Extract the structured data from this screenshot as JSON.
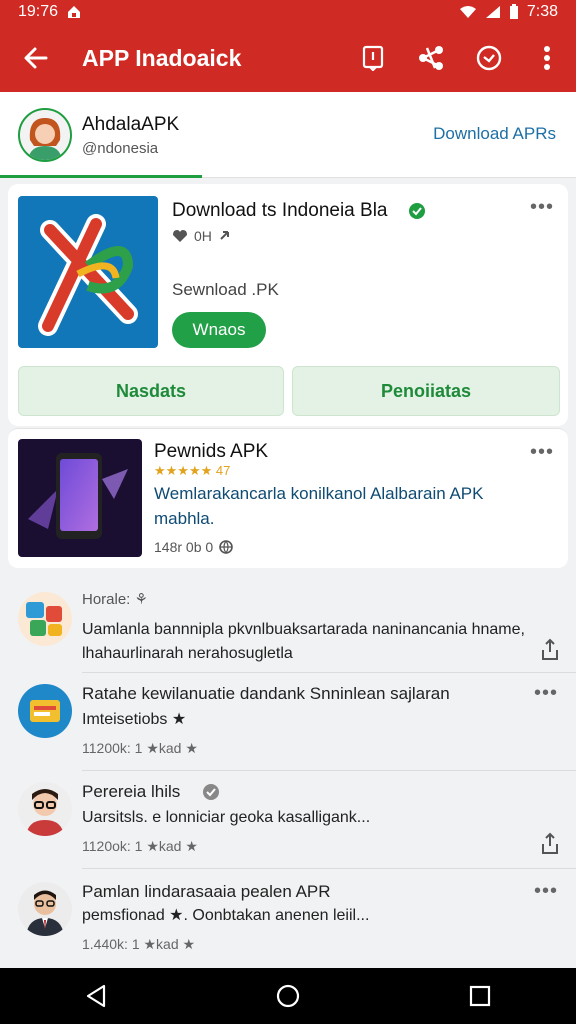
{
  "status": {
    "time_left": "19:76",
    "time_right": "7:38"
  },
  "appbar": {
    "title": "APP Inadoaick"
  },
  "profile": {
    "name": "AhdalaAPK",
    "handle": "@ndonesia",
    "link": "Download APRs"
  },
  "featured": {
    "title": "Download ts Indoneia Bla",
    "meta": "0H",
    "subtitle": "Sewnload .PK",
    "pill": "Wnaos",
    "btn_left": "Nasdats",
    "btn_right": "Penoiiatas"
  },
  "item2": {
    "title": "Pewnids APK",
    "rating": "★★★★★ 47",
    "desc": "Wemlarakancarla konilkanol Alalbarain APK mabhla.",
    "meta": "148r 0b 0"
  },
  "posts": [
    {
      "title": "Horale: ⚘",
      "body": "Uamlanla bannnipla pkvnlbuaksartarada naninancania hname, lhahaurlinarah nerahosugletla",
      "meta": ""
    },
    {
      "title": "Ratahe kewilanuatie dandank Snninlean sajlaran",
      "body": "Imteisetiobs ★",
      "meta": "11200k: 1 ★kad ★"
    },
    {
      "title": "Perereia lhils",
      "body": "Uarsitsls. e lonniciar geoka kasalligank...",
      "meta": "1120ok: 1 ★kad ★"
    },
    {
      "title": "Pamlan lindarasaaia pealen APR",
      "body": "pemsfionad ★. Oonbtakan anenen leiil...",
      "meta": "1.440k: 1 ★kad ★"
    }
  ],
  "colors": {
    "primary": "#cf2a23",
    "accent_green": "#21a047",
    "link_blue": "#1d6fa5"
  },
  "icons": [
    "back-arrow-icon",
    "bookmark-icon",
    "share-icon",
    "clock-icon",
    "more-vert-icon",
    "verified-icon",
    "heart-icon",
    "globe-icon",
    "share-up-icon",
    "nav-back-icon",
    "nav-home-icon",
    "nav-recents-icon"
  ]
}
